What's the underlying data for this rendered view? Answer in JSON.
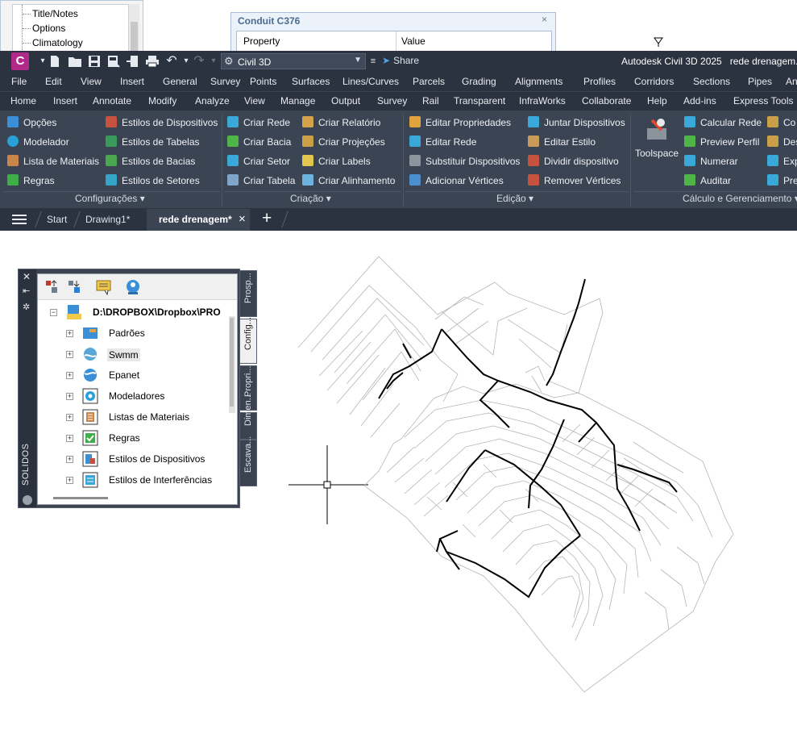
{
  "background_windows": {
    "tree": {
      "items": [
        "Title/Notes",
        "Options",
        "Climatology"
      ]
    },
    "conduit_panel": {
      "title": "Conduit C376",
      "close": "×",
      "columns": [
        "Property",
        "Value"
      ]
    }
  },
  "quick_access": {
    "logo": "C",
    "workspace": "Civil 3D",
    "share_label": "Share",
    "app_title": "Autodesk Civil 3D 2025",
    "file_title": "rede drenagem.d"
  },
  "menu_bar": [
    "File",
    "Edit",
    "View",
    "Insert",
    "General",
    "Survey",
    "Points",
    "Surfaces",
    "Lines/Curves",
    "Parcels",
    "Grading",
    "Alignments",
    "Profiles",
    "Corridors",
    "Sections",
    "Pipes",
    "An"
  ],
  "ribbon_tabs": [
    "Home",
    "Insert",
    "Annotate",
    "Modify",
    "Analyze",
    "View",
    "Manage",
    "Output",
    "Survey",
    "Rail",
    "Transparent",
    "InfraWorks",
    "Collaborate",
    "Help",
    "Add-ins",
    "Express Tools"
  ],
  "ribbon": {
    "configuracoes": {
      "title": "Configurações",
      "col1": [
        "Opções",
        "Modelador",
        "Lista de Materiais",
        "Regras"
      ],
      "col2": [
        "Estilos de Dispositivos",
        "Estilos de Tabelas",
        "Estilos de Bacias",
        "Estilos de Setores"
      ]
    },
    "criacao": {
      "title": "Criação",
      "col1": [
        "Criar Rede",
        "Criar Bacia",
        "Criar Setor",
        "Criar Tabela"
      ],
      "col2": [
        "Criar Relatório",
        "Criar Projeções",
        "Criar Labels",
        "Criar Alinhamento"
      ]
    },
    "edicao": {
      "title": "Edição",
      "col1": [
        "Editar Propriedades",
        "Editar Rede",
        "Substituir Dispositivos",
        "Adicionar Vértices"
      ],
      "col2": [
        "Juntar Dispositivos",
        "Editar Estilo",
        "Dividir dispositivo",
        "Remover Vértices"
      ]
    },
    "calculo": {
      "title": "Cálculo e Gerenciamento",
      "toolspace": "Toolspace",
      "col1": [
        "Calcular Rede",
        "Preview Perfil",
        "Numerar",
        "Auditar"
      ],
      "col2": [
        "Co",
        "Des",
        "Exp",
        "Pre"
      ]
    }
  },
  "doc_tabs": {
    "start": "Start",
    "drawing1": "Drawing1*",
    "active": "rede drenagem*",
    "close": "×",
    "add": "+"
  },
  "palette": {
    "side_title": "SOLIDOS",
    "side_tabs": [
      "Prosp...",
      "Config...",
      "Propri...",
      "Dimen...",
      "Escava..."
    ],
    "root": "D:\\DROPBOX\\Dropbox\\PRO",
    "items": [
      "Padrões",
      "Swmm",
      "Epanet",
      "Modeladores",
      "Listas de Materiais",
      "Regras",
      "Estilos de Dispositivos",
      "Estilos de Interferências"
    ]
  },
  "colors": {
    "app_dark": "#2b3340",
    "ribbon_bg": "#3b4453",
    "logo": "#b12a8a",
    "accent_blue": "#4aa3f0"
  }
}
